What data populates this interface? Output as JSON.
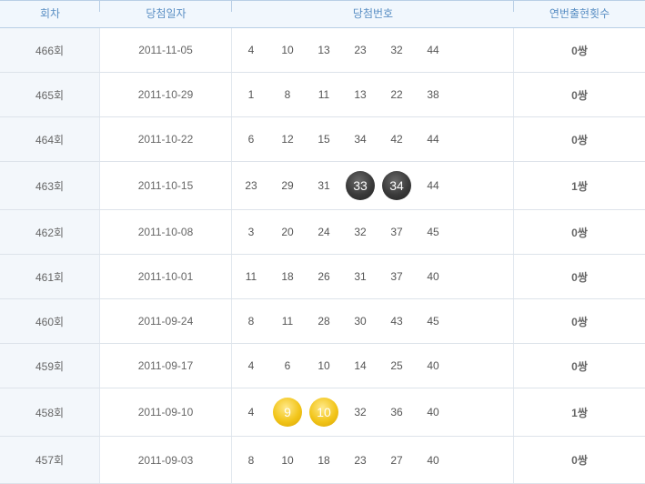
{
  "header": {
    "round_label": "회차",
    "date_label": "당첨일자",
    "numbers_label": "당첨번호",
    "consecutive_label": "연번출현횟수"
  },
  "colors": {
    "dark_ball": "#3a3a3a",
    "gold_ball": "#f2c51a",
    "header_text": "#5a8fc4"
  },
  "rows": [
    {
      "round": "466회",
      "date": "2011-11-05",
      "numbers": [
        "4",
        "10",
        "13",
        "23",
        "32",
        "44"
      ],
      "count": "0쌍"
    },
    {
      "round": "465회",
      "date": "2011-10-29",
      "numbers": [
        "1",
        "8",
        "11",
        "13",
        "22",
        "38"
      ],
      "count": "0쌍"
    },
    {
      "round": "464회",
      "date": "2011-10-22",
      "numbers": [
        "6",
        "12",
        "15",
        "34",
        "42",
        "44"
      ],
      "count": "0쌍"
    },
    {
      "round": "463회",
      "date": "2011-10-15",
      "numbers": [
        "23",
        "29",
        "31",
        "33",
        "34",
        "44"
      ],
      "count": "1쌍"
    },
    {
      "round": "462회",
      "date": "2011-10-08",
      "numbers": [
        "3",
        "20",
        "24",
        "32",
        "37",
        "45"
      ],
      "count": "0쌍"
    },
    {
      "round": "461회",
      "date": "2011-10-01",
      "numbers": [
        "11",
        "18",
        "26",
        "31",
        "37",
        "40"
      ],
      "count": "0쌍"
    },
    {
      "round": "460회",
      "date": "2011-09-24",
      "numbers": [
        "8",
        "11",
        "28",
        "30",
        "43",
        "45"
      ],
      "count": "0쌍"
    },
    {
      "round": "459회",
      "date": "2011-09-17",
      "numbers": [
        "4",
        "6",
        "10",
        "14",
        "25",
        "40"
      ],
      "count": "0쌍"
    },
    {
      "round": "458회",
      "date": "2011-09-10",
      "numbers": [
        "4",
        "9",
        "10",
        "32",
        "36",
        "40"
      ],
      "count": "1쌍"
    },
    {
      "round": "457회",
      "date": "2011-09-03",
      "numbers": [
        "8",
        "10",
        "18",
        "23",
        "27",
        "40"
      ],
      "count": "0쌍"
    }
  ]
}
